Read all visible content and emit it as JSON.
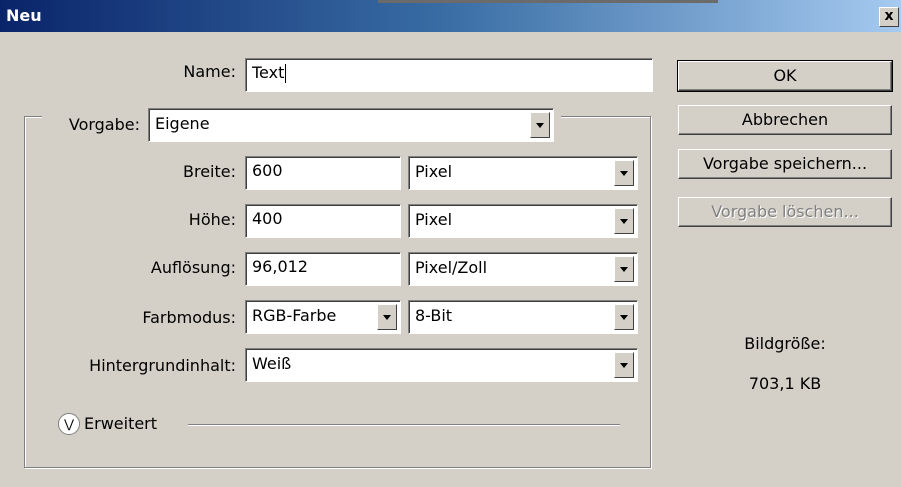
{
  "window": {
    "title": "Neu",
    "close_glyph": "x"
  },
  "form": {
    "name": {
      "label": "Name:",
      "value": "Text"
    },
    "vorgabe": {
      "label": "Vorgabe:",
      "value": "Eigene"
    },
    "breite": {
      "label": "Breite:",
      "value": "600",
      "unit": "Pixel"
    },
    "hoehe": {
      "label": "Höhe:",
      "value": "400",
      "unit": "Pixel"
    },
    "aufloesung": {
      "label": "Auflösung:",
      "value": "96,012",
      "unit": "Pixel/Zoll"
    },
    "farbmodus": {
      "label": "Farbmodus:",
      "value": "RGB-Farbe",
      "depth": "8-Bit"
    },
    "hintergrund": {
      "label": "Hintergrundinhalt:",
      "value": "Weiß"
    },
    "erweitert": {
      "label": "Erweitert"
    }
  },
  "buttons": {
    "ok": "OK",
    "cancel": "Abbrechen",
    "save_preset": "Vorgabe speichern...",
    "delete_preset": "Vorgabe löschen..."
  },
  "info": {
    "label": "Bildgröße:",
    "value": "703,1 KB"
  },
  "colors": {
    "dialog_bg": "#d4d0c8",
    "title_start": "#0a246a",
    "title_end": "#a6caf0"
  },
  "icons": {
    "close": "close-icon",
    "dropdown": "chevron-down-icon",
    "advanced": "double-chevron-down-icon"
  }
}
